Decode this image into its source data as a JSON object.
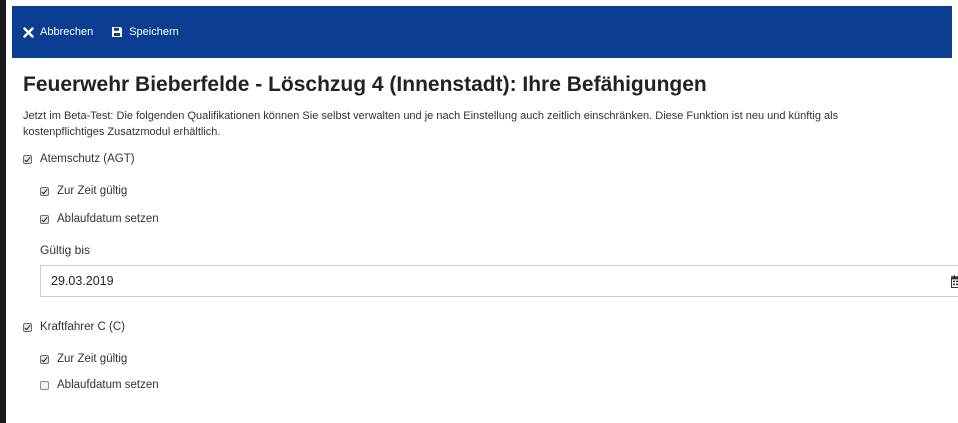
{
  "toolbar": {
    "cancel_label": "Abbrechen",
    "save_label": "Speichern",
    "background": "#0b3d91"
  },
  "page": {
    "title": "Feuerwehr Bieberfelde - Löschzug 4 (Innenstadt): Ihre Befähigungen",
    "intro": "Jetzt im Beta-Test: Die folgenden Qualifikationen können Sie selbst verwalten und je nach Einstellung auch zeitlich einschränken. Diese Funktion ist neu und künftig als kostenpflichtiges Zusatzmodul erhältlich."
  },
  "qualifications": [
    {
      "label": "Atemschutz (AGT)",
      "checked": true,
      "currently_valid": {
        "label": "Zur Zeit gültig",
        "checked": true
      },
      "set_expiry": {
        "label": "Ablaufdatum setzen",
        "checked": true
      },
      "valid_until": {
        "label": "Gültig bis",
        "value": "29.03.2019",
        "icon": "calendar-icon"
      }
    },
    {
      "label": "Kraftfahrer C (C)",
      "checked": true,
      "currently_valid": {
        "label": "Zur Zeit gültig",
        "checked": true
      },
      "set_expiry": {
        "label": "Ablaufdatum setzen",
        "checked": false
      }
    }
  ]
}
